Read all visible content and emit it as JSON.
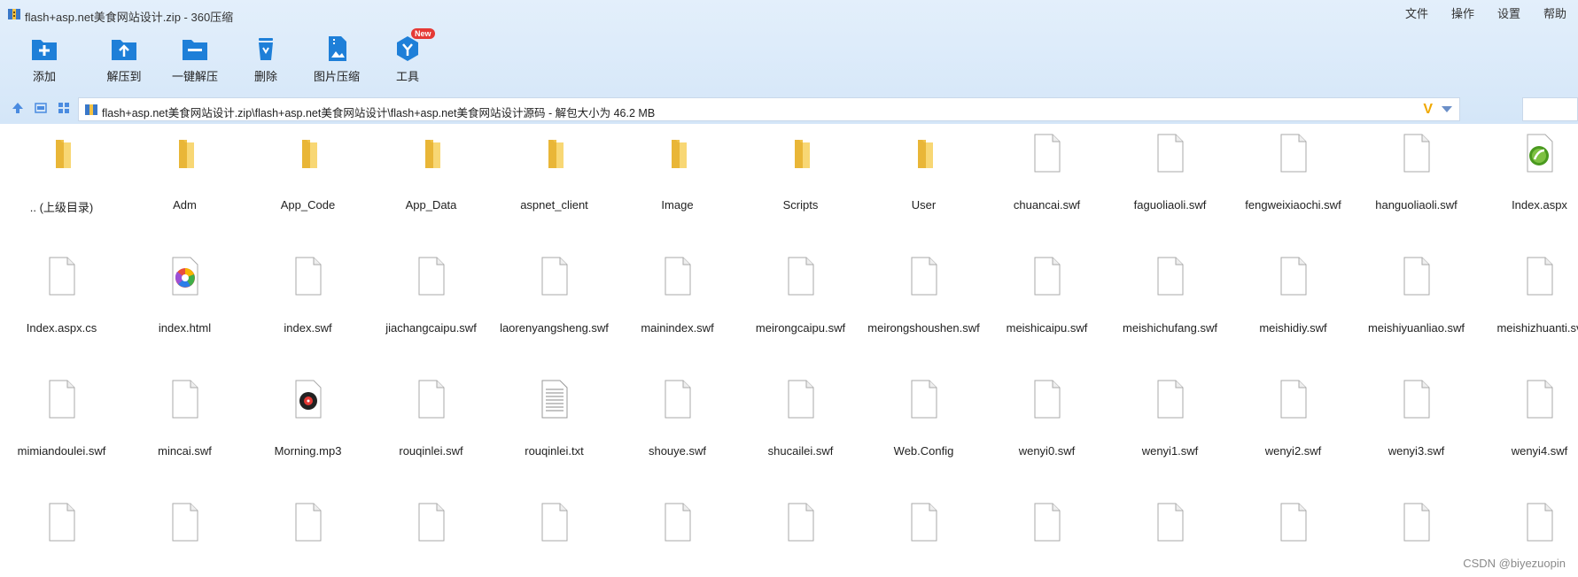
{
  "window": {
    "title": "flash+asp.net美食网站设计.zip - 360压缩",
    "menu": [
      "文件",
      "操作",
      "设置",
      "帮助"
    ]
  },
  "toolbar": {
    "items": [
      {
        "label": "添加",
        "icon": "add-icon"
      },
      {
        "label": "解压到",
        "icon": "extract-to-icon"
      },
      {
        "label": "一键解压",
        "icon": "one-click-extract-icon"
      },
      {
        "label": "删除",
        "icon": "delete-icon"
      },
      {
        "label": "图片压缩",
        "icon": "image-compress-icon"
      },
      {
        "label": "工具",
        "icon": "tools-icon",
        "badge": "New"
      }
    ]
  },
  "address": {
    "path": "flash+asp.net美食网站设计.zip\\flash+asp.net美食网站设计\\flash+asp.net美食网站设计源码 - 解包大小为 46.2 MB",
    "v_mark": "V"
  },
  "files": [
    {
      "name": ".. (上级目录)",
      "type": "folder"
    },
    {
      "name": "Adm",
      "type": "folder"
    },
    {
      "name": "App_Code",
      "type": "folder"
    },
    {
      "name": "App_Data",
      "type": "folder"
    },
    {
      "name": "aspnet_client",
      "type": "folder"
    },
    {
      "name": "Image",
      "type": "folder"
    },
    {
      "name": "Scripts",
      "type": "folder"
    },
    {
      "name": "User",
      "type": "folder"
    },
    {
      "name": "chuancai.swf",
      "type": "file"
    },
    {
      "name": "faguoliaoli.swf",
      "type": "file"
    },
    {
      "name": "fengweixiaochi.swf",
      "type": "file"
    },
    {
      "name": "hanguoliaoli.swf",
      "type": "file"
    },
    {
      "name": "Index.aspx",
      "type": "aspx"
    },
    {
      "name": "Index.aspx.cs",
      "type": "file"
    },
    {
      "name": "index.html",
      "type": "html"
    },
    {
      "name": "index.swf",
      "type": "file"
    },
    {
      "name": "jiachangcaipu.swf",
      "type": "file"
    },
    {
      "name": "laorenyangsheng.swf",
      "type": "file"
    },
    {
      "name": "mainindex.swf",
      "type": "file"
    },
    {
      "name": "meirongcaipu.swf",
      "type": "file"
    },
    {
      "name": "meirongshoushen.swf",
      "type": "file"
    },
    {
      "name": "meishicaipu.swf",
      "type": "file"
    },
    {
      "name": "meishichufang.swf",
      "type": "file"
    },
    {
      "name": "meishidiy.swf",
      "type": "file"
    },
    {
      "name": "meishiyuanliao.swf",
      "type": "file"
    },
    {
      "name": "meishizhuanti.sv",
      "type": "file"
    },
    {
      "name": "mimiandoulei.swf",
      "type": "file"
    },
    {
      "name": "mincai.swf",
      "type": "file"
    },
    {
      "name": "Morning.mp3",
      "type": "mp3"
    },
    {
      "name": "rouqinlei.swf",
      "type": "file"
    },
    {
      "name": "rouqinlei.txt",
      "type": "txt"
    },
    {
      "name": "shouye.swf",
      "type": "file"
    },
    {
      "name": "shucailei.swf",
      "type": "file"
    },
    {
      "name": "Web.Config",
      "type": "file"
    },
    {
      "name": "wenyi0.swf",
      "type": "file"
    },
    {
      "name": "wenyi1.swf",
      "type": "file"
    },
    {
      "name": "wenyi2.swf",
      "type": "file"
    },
    {
      "name": "wenyi3.swf",
      "type": "file"
    },
    {
      "name": "wenyi4.swf",
      "type": "file"
    },
    {
      "name": "",
      "type": "file"
    },
    {
      "name": "",
      "type": "file"
    },
    {
      "name": "",
      "type": "file"
    },
    {
      "name": "",
      "type": "file"
    },
    {
      "name": "",
      "type": "file"
    },
    {
      "name": "",
      "type": "file"
    },
    {
      "name": "",
      "type": "file"
    },
    {
      "name": "",
      "type": "file"
    },
    {
      "name": "",
      "type": "file"
    },
    {
      "name": "",
      "type": "file"
    },
    {
      "name": "",
      "type": "file"
    },
    {
      "name": "",
      "type": "file"
    },
    {
      "name": "",
      "type": "file"
    }
  ],
  "watermark": "CSDN @biyezuopin"
}
